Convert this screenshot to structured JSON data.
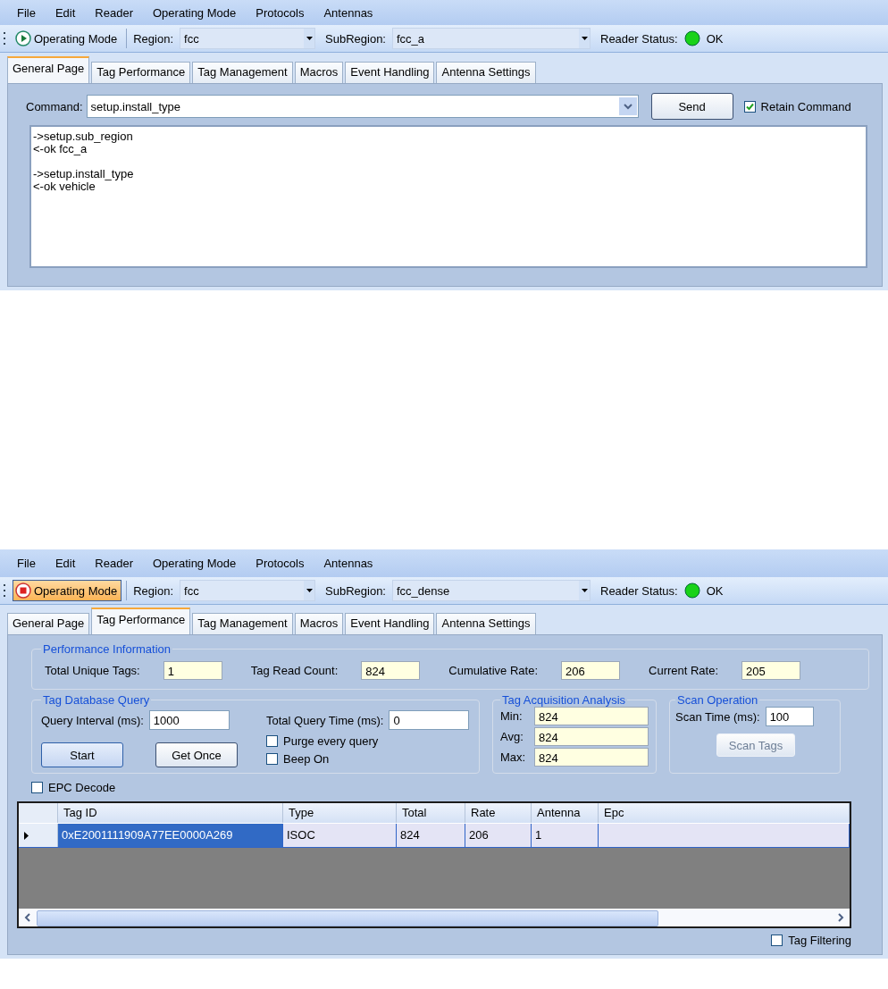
{
  "screens": [
    {
      "kind": "general",
      "menu": [
        "File",
        "Edit",
        "Reader",
        "Operating Mode",
        "Protocols",
        "Antennas"
      ],
      "toolbar": {
        "mode": {
          "label": "Operating Mode",
          "running": false
        },
        "region_label": "Region:",
        "region": "fcc",
        "subregion_label": "SubRegion:",
        "subregion": "fcc_a",
        "status_label": "Reader Status:",
        "status": "OK"
      },
      "tabs": [
        {
          "label": "General Page",
          "selected": true
        },
        {
          "label": "Tag Performance",
          "selected": false
        },
        {
          "label": "Tag Management",
          "selected": false
        },
        {
          "label": "Macros",
          "selected": false
        },
        {
          "label": "Event Handling",
          "selected": false
        },
        {
          "label": "Antenna Settings",
          "selected": false
        }
      ],
      "command": {
        "label": "Command:",
        "value": "setup.install_type",
        "send": "Send",
        "retain": {
          "label": "Retain Command",
          "checked": true
        }
      },
      "console": [
        {
          "lines": [
            "->setup.sub_region",
            "<-ok fcc_a"
          ]
        },
        {
          "lines": [
            "->setup.install_type",
            "<-ok vehicle"
          ]
        }
      ]
    },
    {
      "kind": "performance",
      "menu": [
        "File",
        "Edit",
        "Reader",
        "Operating Mode",
        "Protocols",
        "Antennas"
      ],
      "toolbar": {
        "mode": {
          "label": "Operating Mode",
          "running": true
        },
        "region_label": "Region:",
        "region": "fcc",
        "subregion_label": "SubRegion:",
        "subregion": "fcc_dense",
        "status_label": "Reader Status:",
        "status": "OK"
      },
      "tabs": [
        {
          "label": "General Page",
          "selected": false
        },
        {
          "label": "Tag Performance",
          "selected": true
        },
        {
          "label": "Tag Management",
          "selected": false
        },
        {
          "label": "Macros",
          "selected": false
        },
        {
          "label": "Event Handling",
          "selected": false
        },
        {
          "label": "Antenna Settings",
          "selected": false
        }
      ],
      "performance": {
        "title": "Performance Information",
        "fields": [
          {
            "label": "Total Unique Tags:",
            "value": "1"
          },
          {
            "label": "Tag Read Count:",
            "value": "824"
          },
          {
            "label": "Cumulative Rate:",
            "value": "206"
          },
          {
            "label": "Current Rate:",
            "value": "205"
          }
        ]
      },
      "query": {
        "title": "Tag Database Query",
        "interval_label": "Query Interval (ms):",
        "interval": "1000",
        "total_label": "Total Query Time (ms):",
        "total": "0",
        "buttons": [
          {
            "label": "Start",
            "disabled": false
          },
          {
            "label": "Get Once",
            "disabled": false
          }
        ],
        "options": [
          {
            "label": "Purge every query",
            "checked": false
          },
          {
            "label": "Beep On",
            "checked": false
          }
        ]
      },
      "acquisition": {
        "title": "Tag Acquisition Analysis",
        "fields": [
          {
            "label": "Min:",
            "value": "824"
          },
          {
            "label": "Avg:",
            "value": "824"
          },
          {
            "label": "Max:",
            "value": "824"
          }
        ]
      },
      "scan": {
        "title": "Scan Operation",
        "time_label": "Scan Time (ms):",
        "time": "100",
        "button": {
          "label": "Scan Tags",
          "disabled": true
        }
      },
      "epc_decode": {
        "label": "EPC Decode",
        "checked": false
      },
      "table": {
        "columns": [
          "Tag ID",
          "Type",
          "Total",
          "Rate",
          "Antenna",
          "Epc"
        ],
        "rows": [
          {
            "selected": true,
            "cells": [
              {
                "text": "0xE2001111909A77EE0000A269",
                "selected": true
              },
              {
                "text": "ISOC",
                "selected": false
              },
              {
                "text": "824",
                "selected": false
              },
              {
                "text": "206",
                "selected": false
              },
              {
                "text": "1",
                "selected": false
              }
            ]
          }
        ]
      },
      "tag_filtering": {
        "label": "Tag Filtering",
        "checked": false
      }
    }
  ]
}
